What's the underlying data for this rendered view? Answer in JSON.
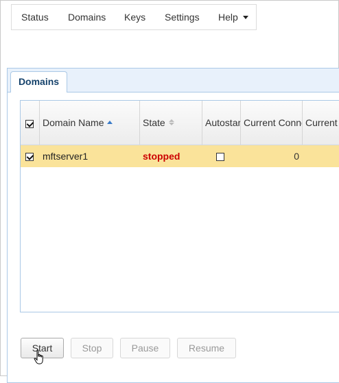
{
  "nav": {
    "items": [
      {
        "label": "Status"
      },
      {
        "label": "Domains"
      },
      {
        "label": "Keys"
      },
      {
        "label": "Settings"
      },
      {
        "label": "Help"
      }
    ],
    "help_icon": "caret-down-icon"
  },
  "panel": {
    "tab_label": "Domains"
  },
  "grid": {
    "columns": [
      {
        "label": "",
        "type": "select-all-checkbox",
        "checked": true
      },
      {
        "label": "Domain Name",
        "sort": "ascending"
      },
      {
        "label": "State",
        "sort": "none"
      },
      {
        "label": "Autostart"
      },
      {
        "label": "Current Connections"
      },
      {
        "label": "Current"
      }
    ],
    "rows": [
      {
        "selected": true,
        "domain_name": "mftserver1",
        "state": "stopped",
        "autostart": false,
        "current_connections": "0",
        "current": ""
      }
    ]
  },
  "buttons": {
    "start": "Start",
    "stop": "Stop",
    "pause": "Pause",
    "resume": "Resume"
  },
  "colors": {
    "selected_row": "#fae39a",
    "state_stopped": "#cc0000",
    "tab_border": "#aac8e6",
    "tab_text": "#15426b"
  }
}
